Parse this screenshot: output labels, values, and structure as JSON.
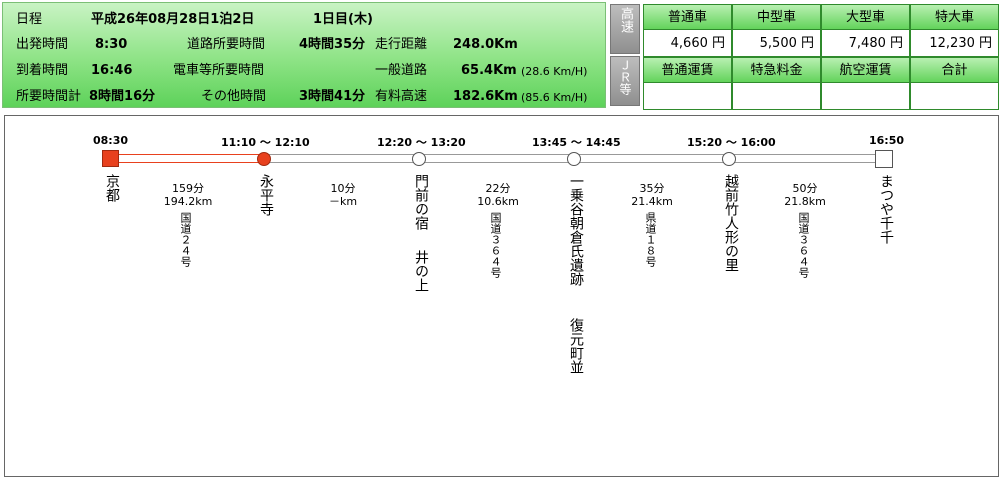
{
  "summary": {
    "schedule_label": "日程",
    "schedule_value": "平成26年08月28日1泊2日",
    "day_value": "1日目(木)",
    "depart_label": "出発時間",
    "depart_value": "8:30",
    "arrive_label": "到着時間",
    "arrive_value": "16:46",
    "total_label": "所要時間計",
    "total_value": "8時間16分",
    "road_time_label": "道路所要時間",
    "road_time_value": "4時間35分",
    "train_time_label": "電車等所要時間",
    "train_time_value": "",
    "other_time_label": "その他時間",
    "other_time_value": "3時間41分",
    "distance_label": "走行距離",
    "distance_value": "248.0Km",
    "general_road_label": "一般道路",
    "general_road_value": "65.4Km",
    "general_road_speed": "(28.6 Km/H)",
    "toll_label": "有料高速",
    "toll_value": "182.6Km",
    "toll_speed": "(85.6 Km/H)"
  },
  "side_tabs": {
    "highway": "高速",
    "jr": "ＪＲ等"
  },
  "fares": {
    "row1_headers": [
      "普通車",
      "中型車",
      "大型車",
      "特大車"
    ],
    "row1_values": [
      "4,660 円",
      "5,500 円",
      "7,480 円",
      "12,230 円"
    ],
    "row2_headers": [
      "普通運賃",
      "特急料金",
      "航空運賃",
      "合計"
    ],
    "row2_values": [
      "",
      "",
      "",
      ""
    ]
  },
  "route": {
    "stops": [
      {
        "time": "08:30",
        "name": "京都"
      },
      {
        "time": "11:10 〜 12:10",
        "name": "永平寺"
      },
      {
        "time": "12:20 〜 13:20",
        "name": "門前の宿",
        "name2": "井の上"
      },
      {
        "time": "13:45 〜 14:45",
        "name": "一乗谷朝倉氏遺跡",
        "name2": "復元町並"
      },
      {
        "time": "15:20 〜 16:00",
        "name": "越前竹人形の里"
      },
      {
        "time": "16:50",
        "name": "まつや千千"
      }
    ],
    "segments": [
      {
        "duration": "159分",
        "distance": "194.2km",
        "road": "国道２４号"
      },
      {
        "duration": "10分",
        "distance": "－km",
        "road": ""
      },
      {
        "duration": "22分",
        "distance": "10.6km",
        "road": "国道３６４号"
      },
      {
        "duration": "35分",
        "distance": "21.4km",
        "road": "県道１８号"
      },
      {
        "duration": "50分",
        "distance": "21.8km",
        "road": "国道３６４号"
      }
    ]
  },
  "colors": {
    "accent_red": "#e8411e",
    "panel_green": "#63d35b",
    "line_gray": "#999999"
  }
}
